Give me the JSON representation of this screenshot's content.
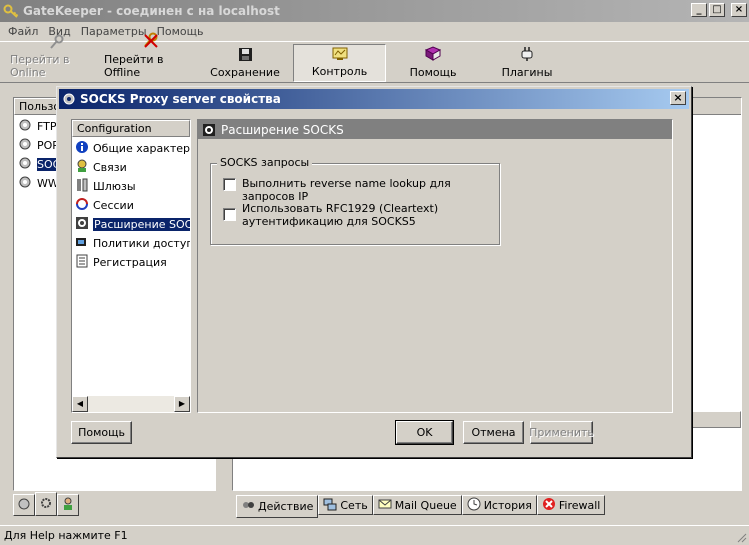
{
  "window": {
    "title": "GateKeeper - соединен с на localhost"
  },
  "menu": [
    "Файл",
    "Вид",
    "Параметры",
    "Помощь"
  ],
  "toolbar": {
    "goto_online": "Перейти в Online",
    "goto_offline": "Перейти в Offline",
    "save": "Сохранение",
    "control": "Контроль",
    "help": "Помощь",
    "plugins": "Плагины"
  },
  "left_panel": {
    "header": "Пользо",
    "items": [
      "FTP",
      "POP",
      "SOC",
      "WW"
    ]
  },
  "bottom_tabs": [
    "Действие",
    "Сеть",
    "Mail Queue",
    "История",
    "Firewall"
  ],
  "status": "Для Help нажмите F1",
  "dialog": {
    "title": "SOCKS Proxy server свойства",
    "tree_header": "Configuration",
    "tree_items": [
      "Общие характери",
      "Связи",
      "Шлюзы",
      "Сессии",
      "Расширение SOCKS",
      "Политики доступа",
      "Регистрация"
    ],
    "page_title": "Расширение SOCKS",
    "group_title": "SOCKS запросы",
    "opt1": "Выполнить reverse name lookup для запросов IP",
    "opt2_line1": "Использовать RFC1929 (Cleartext)",
    "opt2_line2": "аутентификацию для SOCKS5",
    "help_btn": "Помощь",
    "ok_btn": "OK",
    "cancel_btn": "Отмена",
    "apply_btn": "Применить"
  }
}
